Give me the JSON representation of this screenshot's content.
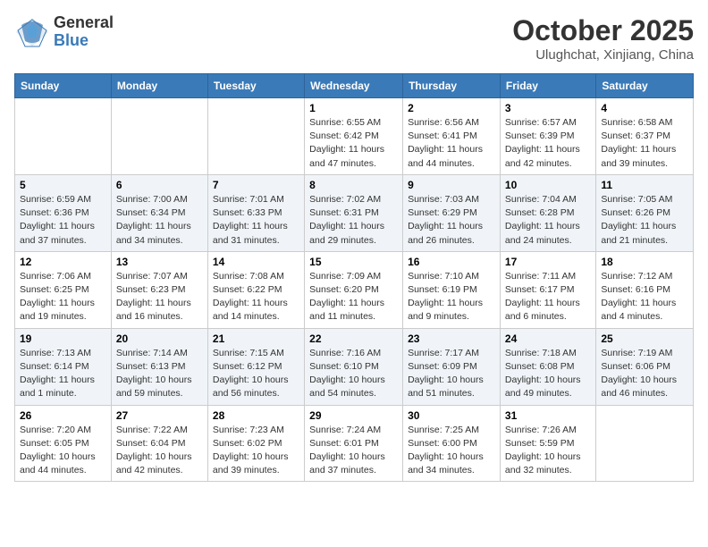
{
  "header": {
    "logo_general": "General",
    "logo_blue": "Blue",
    "month": "October 2025",
    "location": "Ulughchat, Xinjiang, China"
  },
  "days_of_week": [
    "Sunday",
    "Monday",
    "Tuesday",
    "Wednesday",
    "Thursday",
    "Friday",
    "Saturday"
  ],
  "weeks": [
    [
      {
        "day": "",
        "info": ""
      },
      {
        "day": "",
        "info": ""
      },
      {
        "day": "",
        "info": ""
      },
      {
        "day": "1",
        "info": "Sunrise: 6:55 AM\nSunset: 6:42 PM\nDaylight: 11 hours and 47 minutes."
      },
      {
        "day": "2",
        "info": "Sunrise: 6:56 AM\nSunset: 6:41 PM\nDaylight: 11 hours and 44 minutes."
      },
      {
        "day": "3",
        "info": "Sunrise: 6:57 AM\nSunset: 6:39 PM\nDaylight: 11 hours and 42 minutes."
      },
      {
        "day": "4",
        "info": "Sunrise: 6:58 AM\nSunset: 6:37 PM\nDaylight: 11 hours and 39 minutes."
      }
    ],
    [
      {
        "day": "5",
        "info": "Sunrise: 6:59 AM\nSunset: 6:36 PM\nDaylight: 11 hours and 37 minutes."
      },
      {
        "day": "6",
        "info": "Sunrise: 7:00 AM\nSunset: 6:34 PM\nDaylight: 11 hours and 34 minutes."
      },
      {
        "day": "7",
        "info": "Sunrise: 7:01 AM\nSunset: 6:33 PM\nDaylight: 11 hours and 31 minutes."
      },
      {
        "day": "8",
        "info": "Sunrise: 7:02 AM\nSunset: 6:31 PM\nDaylight: 11 hours and 29 minutes."
      },
      {
        "day": "9",
        "info": "Sunrise: 7:03 AM\nSunset: 6:29 PM\nDaylight: 11 hours and 26 minutes."
      },
      {
        "day": "10",
        "info": "Sunrise: 7:04 AM\nSunset: 6:28 PM\nDaylight: 11 hours and 24 minutes."
      },
      {
        "day": "11",
        "info": "Sunrise: 7:05 AM\nSunset: 6:26 PM\nDaylight: 11 hours and 21 minutes."
      }
    ],
    [
      {
        "day": "12",
        "info": "Sunrise: 7:06 AM\nSunset: 6:25 PM\nDaylight: 11 hours and 19 minutes."
      },
      {
        "day": "13",
        "info": "Sunrise: 7:07 AM\nSunset: 6:23 PM\nDaylight: 11 hours and 16 minutes."
      },
      {
        "day": "14",
        "info": "Sunrise: 7:08 AM\nSunset: 6:22 PM\nDaylight: 11 hours and 14 minutes."
      },
      {
        "day": "15",
        "info": "Sunrise: 7:09 AM\nSunset: 6:20 PM\nDaylight: 11 hours and 11 minutes."
      },
      {
        "day": "16",
        "info": "Sunrise: 7:10 AM\nSunset: 6:19 PM\nDaylight: 11 hours and 9 minutes."
      },
      {
        "day": "17",
        "info": "Sunrise: 7:11 AM\nSunset: 6:17 PM\nDaylight: 11 hours and 6 minutes."
      },
      {
        "day": "18",
        "info": "Sunrise: 7:12 AM\nSunset: 6:16 PM\nDaylight: 11 hours and 4 minutes."
      }
    ],
    [
      {
        "day": "19",
        "info": "Sunrise: 7:13 AM\nSunset: 6:14 PM\nDaylight: 11 hours and 1 minute."
      },
      {
        "day": "20",
        "info": "Sunrise: 7:14 AM\nSunset: 6:13 PM\nDaylight: 10 hours and 59 minutes."
      },
      {
        "day": "21",
        "info": "Sunrise: 7:15 AM\nSunset: 6:12 PM\nDaylight: 10 hours and 56 minutes."
      },
      {
        "day": "22",
        "info": "Sunrise: 7:16 AM\nSunset: 6:10 PM\nDaylight: 10 hours and 54 minutes."
      },
      {
        "day": "23",
        "info": "Sunrise: 7:17 AM\nSunset: 6:09 PM\nDaylight: 10 hours and 51 minutes."
      },
      {
        "day": "24",
        "info": "Sunrise: 7:18 AM\nSunset: 6:08 PM\nDaylight: 10 hours and 49 minutes."
      },
      {
        "day": "25",
        "info": "Sunrise: 7:19 AM\nSunset: 6:06 PM\nDaylight: 10 hours and 46 minutes."
      }
    ],
    [
      {
        "day": "26",
        "info": "Sunrise: 7:20 AM\nSunset: 6:05 PM\nDaylight: 10 hours and 44 minutes."
      },
      {
        "day": "27",
        "info": "Sunrise: 7:22 AM\nSunset: 6:04 PM\nDaylight: 10 hours and 42 minutes."
      },
      {
        "day": "28",
        "info": "Sunrise: 7:23 AM\nSunset: 6:02 PM\nDaylight: 10 hours and 39 minutes."
      },
      {
        "day": "29",
        "info": "Sunrise: 7:24 AM\nSunset: 6:01 PM\nDaylight: 10 hours and 37 minutes."
      },
      {
        "day": "30",
        "info": "Sunrise: 7:25 AM\nSunset: 6:00 PM\nDaylight: 10 hours and 34 minutes."
      },
      {
        "day": "31",
        "info": "Sunrise: 7:26 AM\nSunset: 5:59 PM\nDaylight: 10 hours and 32 minutes."
      },
      {
        "day": "",
        "info": ""
      }
    ]
  ]
}
